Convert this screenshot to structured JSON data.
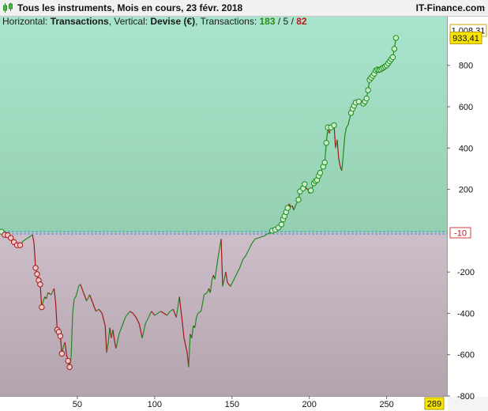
{
  "header": {
    "title": "Tous les instruments, Mois en cours, 23 févr. 2018",
    "brand": "IT-Finance.com"
  },
  "info": {
    "horizontal_label": "Horizontal: ",
    "horizontal_value": "Transactions",
    "vertical_label": ", Vertical: ",
    "vertical_value": "Devise (€)",
    "transactions_label": ", Transactions: ",
    "transactions_total": "183",
    "sep1": " / ",
    "transactions_neutral": "5",
    "sep2": " / ",
    "transactions_loss": "82"
  },
  "badges": {
    "max_value": "1 008,31",
    "last_value": "933,41",
    "baseline_value": "-10",
    "x_end": "289"
  },
  "colors": {
    "positive_zone_top": "#a9e5cd",
    "positive_zone_bottom": "#94cfb0",
    "negative_zone_top": "#cdbfc9",
    "negative_zone_bottom": "#b3a3ae",
    "rising_line": "#1f8a1f",
    "falling_line": "#a31515",
    "baseline": "#4a8bd6"
  },
  "chart_data": {
    "type": "line",
    "xlabel": "",
    "ylabel": "",
    "xlim": [
      0,
      289
    ],
    "ylim": [
      -800,
      1040
    ],
    "x_ticks": [
      50,
      100,
      150,
      200,
      250
    ],
    "y_ticks": [
      -800,
      -600,
      -400,
      -200,
      200,
      400,
      600,
      800
    ],
    "baseline": -10,
    "grid": false,
    "series": [
      {
        "values": [
          [
            1,
            -5
          ],
          [
            3,
            -20
          ],
          [
            5,
            -22
          ],
          [
            7,
            -35
          ],
          [
            9,
            -55
          ],
          [
            11,
            -70
          ],
          [
            13,
            -70
          ],
          [
            15,
            -50
          ],
          [
            17,
            -40
          ],
          [
            19,
            -30
          ],
          [
            21,
            -20
          ],
          [
            22,
            -60
          ],
          [
            23,
            -180
          ],
          [
            24,
            -210
          ],
          [
            25,
            -240
          ],
          [
            26,
            -260
          ],
          [
            27,
            -370
          ],
          [
            28,
            -340
          ],
          [
            29,
            -320
          ],
          [
            30,
            -330
          ],
          [
            31,
            -300
          ],
          [
            33,
            -310
          ],
          [
            35,
            -280
          ],
          [
            36,
            -350
          ],
          [
            37,
            -480
          ],
          [
            38,
            -490
          ],
          [
            39,
            -510
          ],
          [
            40,
            -595
          ],
          [
            41,
            -560
          ],
          [
            42,
            -540
          ],
          [
            43,
            -600
          ],
          [
            44,
            -630
          ],
          [
            45,
            -660
          ],
          [
            46,
            -610
          ],
          [
            47,
            -400
          ],
          [
            48,
            -330
          ],
          [
            49,
            -320
          ],
          [
            50,
            -295
          ],
          [
            51,
            -265
          ],
          [
            52,
            -260
          ],
          [
            54,
            -300
          ],
          [
            56,
            -340
          ],
          [
            58,
            -310
          ],
          [
            60,
            -350
          ],
          [
            62,
            -390
          ],
          [
            64,
            -380
          ],
          [
            66,
            -400
          ],
          [
            68,
            -460
          ],
          [
            69,
            -590
          ],
          [
            70,
            -540
          ],
          [
            71,
            -470
          ],
          [
            72,
            -520
          ],
          [
            73,
            -480
          ],
          [
            74,
            -530
          ],
          [
            75,
            -570
          ],
          [
            77,
            -500
          ],
          [
            79,
            -460
          ],
          [
            81,
            -420
          ],
          [
            82,
            -410
          ],
          [
            84,
            -390
          ],
          [
            86,
            -400
          ],
          [
            88,
            -420
          ],
          [
            90,
            -450
          ],
          [
            92,
            -520
          ],
          [
            94,
            -450
          ],
          [
            96,
            -420
          ],
          [
            98,
            -390
          ],
          [
            100,
            -410
          ],
          [
            102,
            -400
          ],
          [
            104,
            -390
          ],
          [
            106,
            -400
          ],
          [
            108,
            -410
          ],
          [
            110,
            -390
          ],
          [
            112,
            -380
          ],
          [
            114,
            -420
          ],
          [
            116,
            -320
          ],
          [
            118,
            -450
          ],
          [
            119,
            -520
          ],
          [
            121,
            -590
          ],
          [
            122,
            -660
          ],
          [
            123,
            -500
          ],
          [
            124,
            -520
          ],
          [
            125,
            -460
          ],
          [
            126,
            -470
          ],
          [
            127,
            -420
          ],
          [
            128,
            -400
          ],
          [
            130,
            -390
          ],
          [
            132,
            -310
          ],
          [
            134,
            -300
          ],
          [
            135,
            -280
          ],
          [
            136,
            -300
          ],
          [
            137,
            -240
          ],
          [
            138,
            -215
          ],
          [
            139,
            -235
          ],
          [
            141,
            -130
          ],
          [
            143,
            -40
          ],
          [
            144,
            -270
          ],
          [
            146,
            -200
          ],
          [
            147,
            -250
          ],
          [
            149,
            -270
          ],
          [
            151,
            -240
          ],
          [
            153,
            -210
          ],
          [
            155,
            -180
          ],
          [
            157,
            -140
          ],
          [
            159,
            -120
          ],
          [
            161,
            -90
          ],
          [
            163,
            -60
          ],
          [
            165,
            -40
          ],
          [
            167,
            -35
          ],
          [
            169,
            -30
          ],
          [
            171,
            -25
          ],
          [
            173,
            -15
          ],
          [
            175,
            -10
          ],
          [
            176,
            0
          ],
          [
            178,
            5
          ],
          [
            180,
            15
          ],
          [
            182,
            30
          ],
          [
            183,
            55
          ],
          [
            184,
            70
          ],
          [
            185,
            90
          ],
          [
            186,
            110
          ],
          [
            187,
            130
          ],
          [
            188,
            115
          ],
          [
            189,
            120
          ],
          [
            190,
            100
          ],
          [
            191,
            120
          ],
          [
            193,
            150
          ],
          [
            194,
            190
          ],
          [
            195,
            195
          ],
          [
            196,
            205
          ],
          [
            197,
            225
          ],
          [
            198,
            205
          ],
          [
            199,
            200
          ],
          [
            200,
            180
          ],
          [
            201,
            195
          ],
          [
            202,
            210
          ],
          [
            203,
            230
          ],
          [
            204,
            240
          ],
          [
            205,
            245
          ],
          [
            206,
            265
          ],
          [
            207,
            280
          ],
          [
            208,
            295
          ],
          [
            209,
            310
          ],
          [
            210,
            330
          ],
          [
            211,
            425
          ],
          [
            212,
            500
          ],
          [
            213,
            470
          ],
          [
            214,
            500
          ],
          [
            215,
            505
          ],
          [
            216,
            510
          ],
          [
            217,
            400
          ],
          [
            218,
            440
          ],
          [
            219,
            350
          ],
          [
            220,
            310
          ],
          [
            221,
            290
          ],
          [
            222,
            370
          ],
          [
            223,
            460
          ],
          [
            224,
            500
          ],
          [
            225,
            510
          ],
          [
            226,
            540
          ],
          [
            227,
            570
          ],
          [
            228,
            590
          ],
          [
            229,
            605
          ],
          [
            230,
            620
          ],
          [
            231,
            610
          ],
          [
            232,
            625
          ],
          [
            233,
            620
          ],
          [
            234,
            605
          ],
          [
            235,
            615
          ],
          [
            236,
            625
          ],
          [
            237,
            640
          ],
          [
            238,
            680
          ],
          [
            239,
            730
          ],
          [
            240,
            740
          ],
          [
            241,
            750
          ],
          [
            242,
            760
          ],
          [
            243,
            775
          ],
          [
            244,
            780
          ],
          [
            245,
            778
          ],
          [
            246,
            780
          ],
          [
            247,
            785
          ],
          [
            248,
            790
          ],
          [
            249,
            795
          ],
          [
            250,
            800
          ],
          [
            251,
            810
          ],
          [
            252,
            820
          ],
          [
            253,
            830
          ],
          [
            254,
            840
          ],
          [
            255,
            880
          ],
          [
            256,
            933
          ]
        ],
        "markers": [
          [
            1,
            -5
          ],
          [
            3,
            -20
          ],
          [
            5,
            -22
          ],
          [
            7,
            -35
          ],
          [
            9,
            -55
          ],
          [
            11,
            -70
          ],
          [
            13,
            -70
          ],
          [
            23,
            -180
          ],
          [
            24,
            -210
          ],
          [
            25,
            -240
          ],
          [
            26,
            -260
          ],
          [
            27,
            -370
          ],
          [
            37,
            -480
          ],
          [
            38,
            -490
          ],
          [
            39,
            -510
          ],
          [
            40,
            -595
          ],
          [
            44,
            -630
          ],
          [
            45,
            -660
          ],
          [
            176,
            0
          ],
          [
            178,
            5
          ],
          [
            180,
            15
          ],
          [
            182,
            30
          ],
          [
            183,
            55
          ],
          [
            184,
            70
          ],
          [
            185,
            90
          ],
          [
            186,
            110
          ],
          [
            193,
            150
          ],
          [
            194,
            190
          ],
          [
            196,
            205
          ],
          [
            197,
            225
          ],
          [
            201,
            195
          ],
          [
            203,
            230
          ],
          [
            204,
            240
          ],
          [
            205,
            245
          ],
          [
            206,
            265
          ],
          [
            207,
            280
          ],
          [
            209,
            310
          ],
          [
            210,
            330
          ],
          [
            211,
            425
          ],
          [
            212,
            500
          ],
          [
            214,
            500
          ],
          [
            216,
            510
          ],
          [
            227,
            570
          ],
          [
            228,
            590
          ],
          [
            229,
            605
          ],
          [
            230,
            620
          ],
          [
            232,
            625
          ],
          [
            235,
            615
          ],
          [
            236,
            625
          ],
          [
            237,
            640
          ],
          [
            238,
            680
          ],
          [
            239,
            730
          ],
          [
            240,
            740
          ],
          [
            241,
            750
          ],
          [
            242,
            760
          ],
          [
            243,
            775
          ],
          [
            244,
            780
          ],
          [
            245,
            778
          ],
          [
            246,
            780
          ],
          [
            247,
            785
          ],
          [
            248,
            790
          ],
          [
            249,
            795
          ],
          [
            250,
            800
          ],
          [
            251,
            810
          ],
          [
            252,
            820
          ],
          [
            253,
            830
          ],
          [
            254,
            840
          ],
          [
            255,
            880
          ],
          [
            256,
            933
          ]
        ]
      }
    ]
  }
}
